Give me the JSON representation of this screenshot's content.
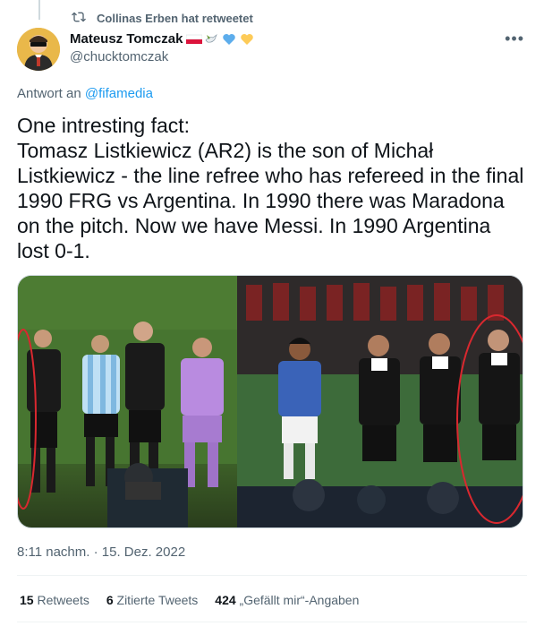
{
  "retweet_banner": {
    "text": "Collinas Erben hat retweetet"
  },
  "author": {
    "name": "Mateusz Tomczak",
    "handle": "@chucktomczak",
    "badges": [
      "poland-flag",
      "dove",
      "blue-heart",
      "yellow-heart"
    ]
  },
  "reply": {
    "prefix": "Antwort an ",
    "mention": "@fifamedia"
  },
  "tweet": {
    "text": "One intresting fact:\nTomasz Listkiewicz (AR2) is the son of Michał Listkiewicz - the line refree who has refereed in the final 1990 FRG vs Argentina. In 1990 there was Maradona on the pitch. Now we have Messi. In 1990 Argentina lost 0-1."
  },
  "timestamp": "8:11 nachm. · 15. Dez. 2022",
  "stats": {
    "retweets_count": "15",
    "retweets_label": "Retweets",
    "quotes_count": "6",
    "quotes_label": "Zitierte Tweets",
    "likes_count": "424",
    "likes_label": "„Gefällt mir“-Angaben"
  },
  "colors": {
    "link": "#1d9bf0",
    "muted": "#536471",
    "text": "#0f1419",
    "highlight_circle": "#d9282f"
  }
}
